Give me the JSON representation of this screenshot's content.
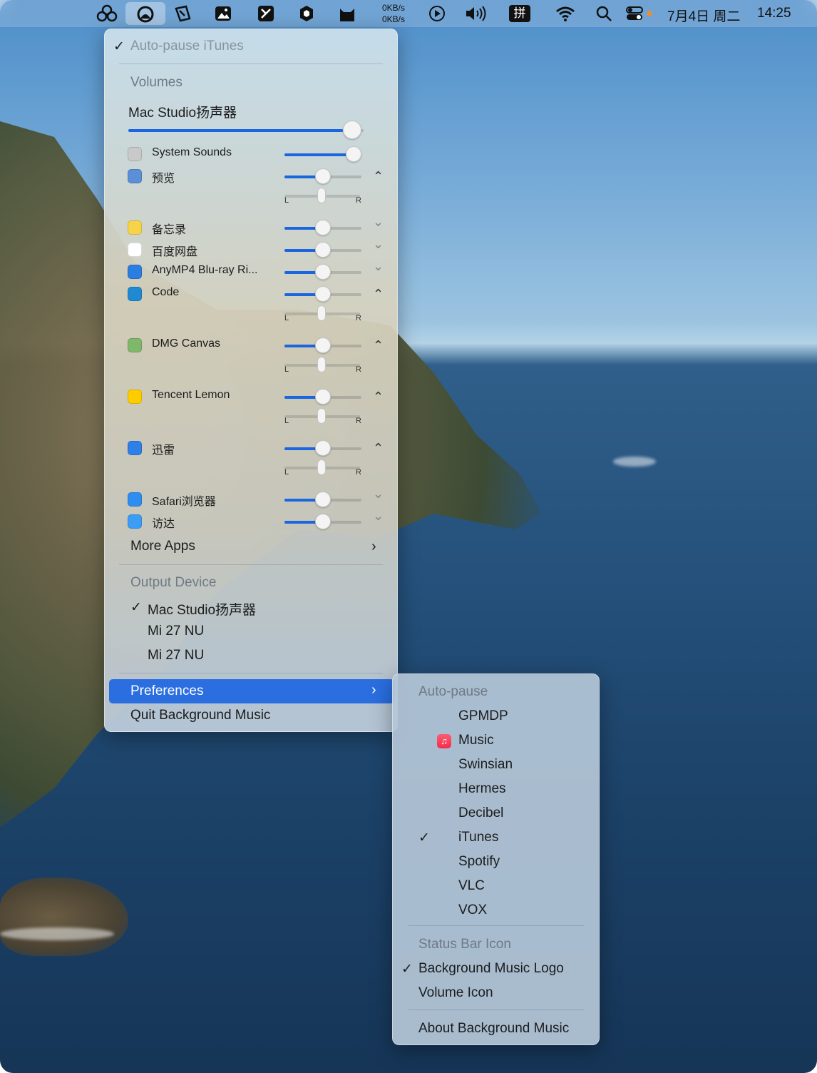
{
  "menubar": {
    "net_up": "0KB/s",
    "net_down": "0KB/s",
    "date": "7月4日 周二",
    "time": "14:25",
    "icons": [
      "bgm-app-icon",
      "background-music-icon",
      "edit-icon",
      "photo-icon",
      "kanban-icon",
      "shield-icon",
      "cat-icon",
      "play-icon",
      "volume-icon",
      "input-method-icon",
      "wifi-icon",
      "search-icon",
      "control-center-icon"
    ],
    "input_method_glyph": "拼"
  },
  "menu": {
    "auto_pause_label": "Auto-pause iTunes",
    "volumes_header": "Volumes",
    "device_name": "Mac Studio扬声器",
    "device_volume": 0.95,
    "apps": [
      {
        "name": "System Sounds",
        "volume": 0.9,
        "expanded": null,
        "icon": "system-sounds-icon",
        "icon_color": "#c9c9c9"
      },
      {
        "name": "预览",
        "volume": 0.5,
        "expanded": true,
        "icon": "preview-icon",
        "icon_color": "#5b8fd8"
      },
      {
        "name": "备忘录",
        "volume": 0.5,
        "expanded": false,
        "icon": "notes-icon",
        "icon_color": "#f5d44a"
      },
      {
        "name": "百度网盘",
        "volume": 0.5,
        "expanded": false,
        "icon": "baidu-netdisk-icon",
        "icon_color": "#ffffff"
      },
      {
        "name": "AnyMP4 Blu-ray Ri...",
        "volume": 0.5,
        "expanded": false,
        "icon": "anymp4-icon",
        "icon_color": "#2a7de1"
      },
      {
        "name": "Code",
        "volume": 0.5,
        "expanded": true,
        "icon": "vscode-icon",
        "icon_color": "#1f8ad2"
      },
      {
        "name": "DMG Canvas",
        "volume": 0.5,
        "expanded": true,
        "icon": "dmg-canvas-icon",
        "icon_color": "#7fb86a"
      },
      {
        "name": "Tencent Lemon",
        "volume": 0.5,
        "expanded": true,
        "icon": "tencent-lemon-icon",
        "icon_color": "#ffcc00"
      },
      {
        "name": "迅雷",
        "volume": 0.5,
        "expanded": true,
        "icon": "xunlei-icon",
        "icon_color": "#2f7fe8"
      },
      {
        "name": "Safari浏览器",
        "volume": 0.5,
        "expanded": false,
        "icon": "safari-icon",
        "icon_color": "#2d8df0"
      },
      {
        "name": "访达",
        "volume": 0.5,
        "expanded": false,
        "icon": "finder-icon",
        "icon_color": "#3b9df5"
      }
    ],
    "pan_left": "L",
    "pan_right": "R",
    "more_apps": "More Apps",
    "output_header": "Output Device",
    "outputs": [
      {
        "name": "Mac Studio扬声器",
        "checked": true
      },
      {
        "name": "Mi 27 NU",
        "checked": false
      },
      {
        "name": "Mi 27 NU",
        "checked": false
      }
    ],
    "preferences": "Preferences",
    "quit": "Quit Background Music"
  },
  "submenu": {
    "autopause_header": "Auto-pause",
    "players": [
      {
        "name": "GPMDP",
        "checked": false
      },
      {
        "name": "Music",
        "checked": false,
        "icon": "apple-music-icon"
      },
      {
        "name": "Swinsian",
        "checked": false
      },
      {
        "name": "Hermes",
        "checked": false
      },
      {
        "name": "Decibel",
        "checked": false
      },
      {
        "name": "iTunes",
        "checked": true
      },
      {
        "name": "Spotify",
        "checked": false
      },
      {
        "name": "VLC",
        "checked": false
      },
      {
        "name": "VOX",
        "checked": false
      }
    ],
    "status_header": "Status Bar Icon",
    "status_options": [
      {
        "name": "Background Music Logo",
        "checked": true
      },
      {
        "name": "Volume Icon",
        "checked": false
      }
    ],
    "about": "About Background Music"
  },
  "colors": {
    "accent": "#1a66e0",
    "highlight": "#2a6ee0"
  }
}
